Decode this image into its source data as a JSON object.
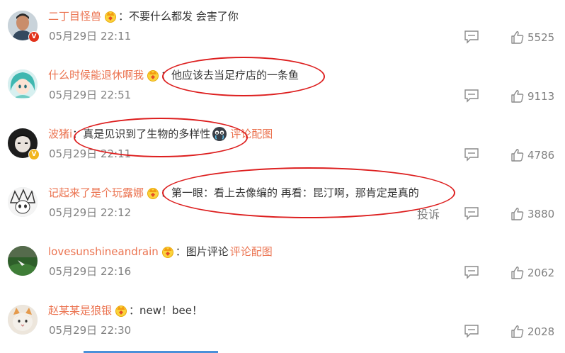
{
  "colors": {
    "username": "#eb7350",
    "text": "#333333",
    "meta": "#808080",
    "annotation": "#dd1f1f",
    "badge_red": "#e2321b",
    "badge_gold": "#f2b51d"
  },
  "comments": [
    {
      "username": "二丁目怪兽",
      "separator": "：",
      "text": "不要什么都发 会害了你",
      "time": "05月29日 22:11",
      "likes": "5525",
      "badge": "red",
      "avatar": "man-portrait"
    },
    {
      "username": "什么时候能退休啊我",
      "separator": "：",
      "text": "他应该去当足疗店的一条鱼",
      "time": "05月29日 22:51",
      "likes": "9113",
      "badge": "none",
      "avatar": "anime-girl-teal-hair"
    },
    {
      "username": "波猪i",
      "separator": "：",
      "text": "真是见识到了生物的多样性",
      "emoji": "crying-emoji",
      "pic_link": "评论配图",
      "time": "05月29日 22:11",
      "likes": "4786",
      "badge": "gold",
      "avatar": "dark-anime-character"
    },
    {
      "username": "记起来了是个玩露娜",
      "separator": "：",
      "text": "第一眼：看上去像编的 再看：昆汀啊，那肯定是真的",
      "time": "05月29日 22:12",
      "report": "投诉",
      "likes": "3880",
      "badge": "none",
      "avatar": "manga-sketch"
    },
    {
      "username": "lovesunshineandrain",
      "separator": "：",
      "text": "图片评论",
      "pic_link": "评论配图",
      "time": "05月29日 22:16",
      "likes": "2062",
      "badge": "none",
      "avatar": "green-landscape"
    },
    {
      "username": "赵某某是狼银",
      "separator": "：",
      "text": "new！bee！",
      "time": "05月29日 22:30",
      "likes": "2028",
      "badge": "none",
      "avatar": "orange-cat"
    }
  ]
}
